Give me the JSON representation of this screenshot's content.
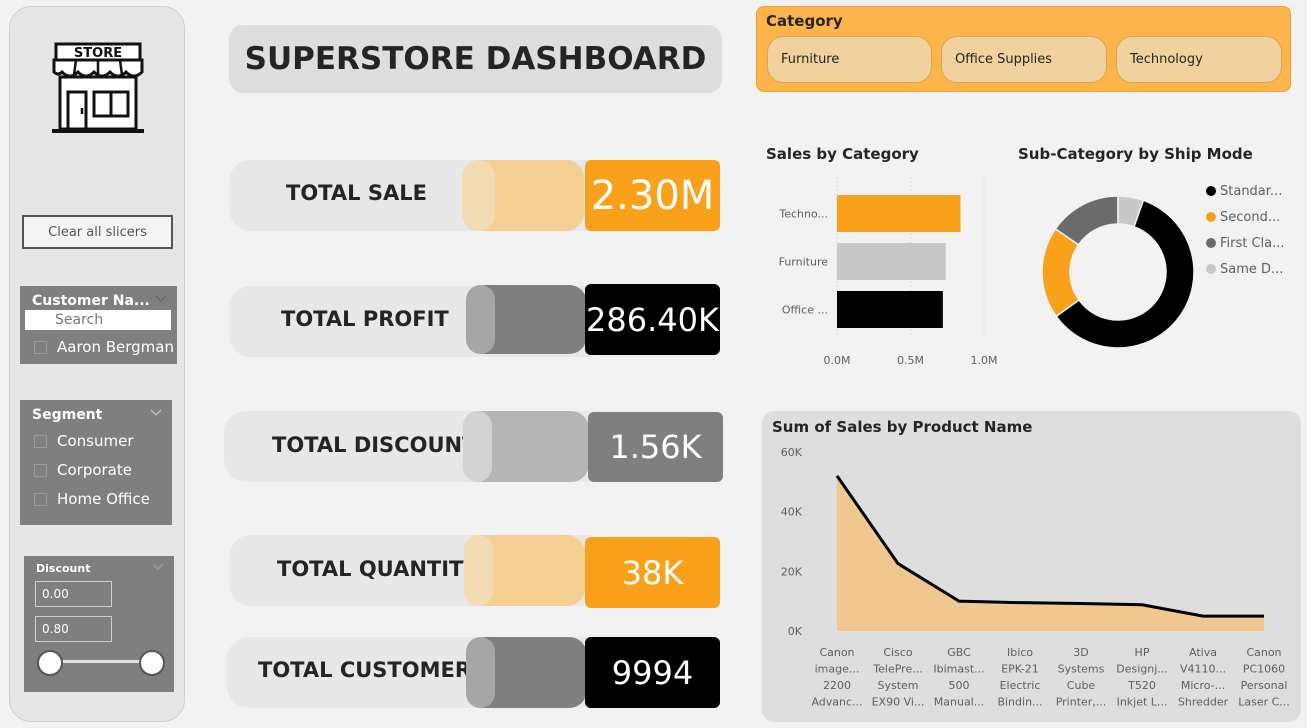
{
  "sidebar": {
    "logo_text": "STORE",
    "clear_button": "Clear all slicers",
    "customer_slicer": {
      "title": "Customer Na...",
      "search_placeholder": "Search",
      "items": [
        "Aaron Bergman"
      ]
    },
    "segment_slicer": {
      "title": "Segment",
      "items": [
        "Consumer",
        "Corporate",
        "Home Office"
      ]
    },
    "discount_slicer": {
      "title": "Discount",
      "min": "0.00",
      "max": "0.80"
    }
  },
  "header": {
    "title": "SUPERSTORE DASHBOARD"
  },
  "kpis": [
    {
      "label": "TOTAL SALE",
      "value": "2.30M"
    },
    {
      "label": "TOTAL PROFIT",
      "value": "286.40K"
    },
    {
      "label": "TOTAL DISCOUNT",
      "value": "1.56K"
    },
    {
      "label": "TOTAL QUANTITY",
      "value": "38K"
    },
    {
      "label": "TOTAL CUSTOMERS",
      "value": "9994"
    }
  ],
  "category_slicer": {
    "title": "Category",
    "options": [
      "Furniture",
      "Office Supplies",
      "Technology"
    ]
  },
  "colors": {
    "orange": "#f9a11b",
    "light_orange": "#f5cf93",
    "black": "#000000",
    "gray": "#7f7f7f",
    "light_gray": "#c8c8c8"
  },
  "chart_data": [
    {
      "type": "bar",
      "title": "Sales by Category",
      "categories": [
        "Techno...",
        "Furniture",
        "Office ..."
      ],
      "values": [
        0.84,
        0.74,
        0.72
      ],
      "x_ticks": [
        "0.0M",
        "0.5M",
        "1.0M"
      ],
      "xlim": [
        0,
        1.0
      ],
      "bar_colors": [
        "#f9a11b",
        "#c8c8c8",
        "#000000"
      ]
    },
    {
      "type": "pie",
      "title": "Sub-Category by Ship Mode",
      "legend": [
        "Standar...",
        "Second...",
        "First Cla...",
        "Same D..."
      ],
      "values": [
        59.7,
        19.5,
        15.4,
        5.4
      ],
      "colors": [
        "#000000",
        "#f9a11b",
        "#6b6b6b",
        "#c8c8c8"
      ],
      "legend_position": "right"
    },
    {
      "type": "area",
      "title": "Sum of Sales by Product Name",
      "categories": [
        [
          "Canon",
          "image...",
          "2200",
          "Advanc..."
        ],
        [
          "Cisco",
          "TelePre...",
          "System",
          "EX90 Vi..."
        ],
        [
          "GBC",
          "Ibimast...",
          "500",
          "Manual..."
        ],
        [
          "Ibico",
          "EPK-21",
          "Electric",
          "Bindin..."
        ],
        [
          "3D",
          "Systems",
          "Cube",
          "Printer,..."
        ],
        [
          "HP",
          "Designj...",
          "T520",
          "Inkjet L..."
        ],
        [
          "Ativa",
          "V4110...",
          "Micro-...",
          "Shredder"
        ],
        [
          "Canon",
          "PC1060",
          "Personal",
          "Laser C..."
        ]
      ],
      "values": [
        52,
        22.6,
        10,
        9.5,
        9.2,
        8.8,
        5,
        5
      ],
      "y_ticks": [
        "0K",
        "20K",
        "40K",
        "60K"
      ],
      "ylim": [
        0,
        60
      ],
      "fill": "#f0c88f",
      "line": "#000000"
    }
  ]
}
